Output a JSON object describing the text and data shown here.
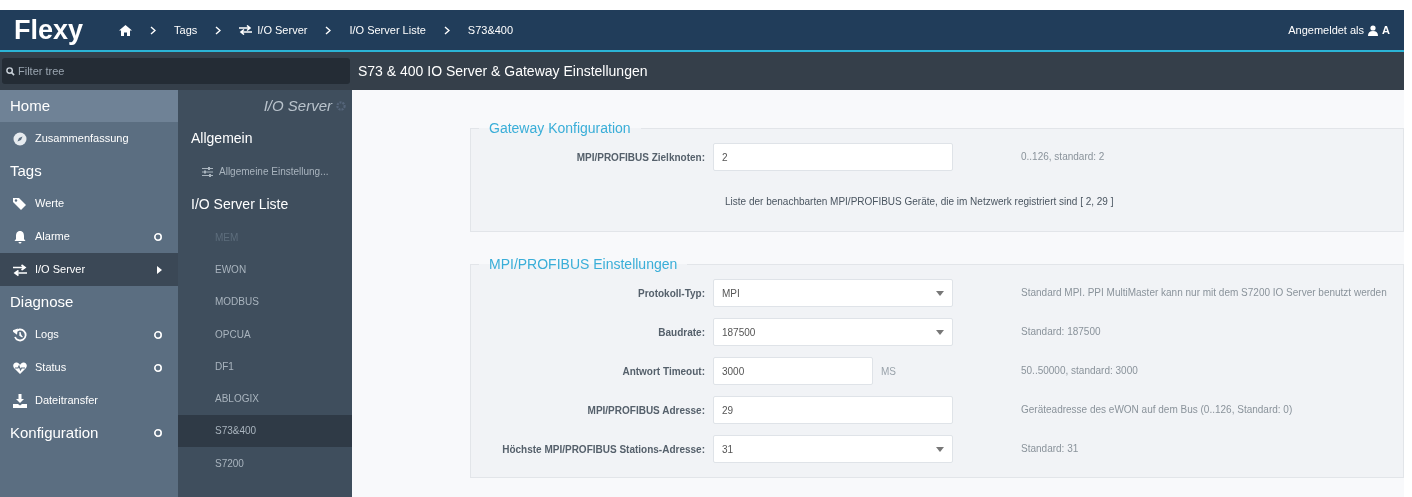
{
  "header": {
    "logo": "Flexy",
    "breadcrumbs": [
      "Tags",
      "I/O Server",
      "I/O Server Liste",
      "S73&400"
    ],
    "login_label": "Angemeldet als",
    "user": "A"
  },
  "filter": {
    "placeholder": "Filter tree"
  },
  "page_title": "S73 & 400 IO Server & Gateway Einstellungen",
  "nav": [
    {
      "kind": "header",
      "label": "Home",
      "selected": true,
      "expandable": false
    },
    {
      "kind": "item",
      "label": "Zusammenfassung",
      "selected": false,
      "expandable": false
    },
    {
      "kind": "header",
      "label": "Tags",
      "selected": false,
      "expandable": false
    },
    {
      "kind": "item",
      "label": "Werte",
      "selected": false,
      "expandable": false
    },
    {
      "kind": "item",
      "label": "Alarme",
      "selected": false,
      "expandable": true
    },
    {
      "kind": "item",
      "label": "I/O Server",
      "selected": true,
      "expandable": false
    },
    {
      "kind": "header",
      "label": "Diagnose",
      "selected": false,
      "expandable": false
    },
    {
      "kind": "item",
      "label": "Logs",
      "selected": false,
      "expandable": true
    },
    {
      "kind": "item",
      "label": "Status",
      "selected": false,
      "expandable": true
    },
    {
      "kind": "item",
      "label": "Dateitransfer",
      "selected": false,
      "expandable": false
    },
    {
      "kind": "header",
      "label": "Konfiguration",
      "selected": false,
      "expandable": true
    }
  ],
  "subnav": {
    "title": "I/O Server",
    "entries": [
      {
        "kind": "header",
        "label": "Allgemein"
      },
      {
        "kind": "setting",
        "label": "Allgemeine Einstellung..."
      },
      {
        "kind": "header",
        "label": "I/O Server Liste"
      },
      {
        "kind": "server",
        "label": "MEM",
        "selected": false,
        "disabled": true
      },
      {
        "kind": "server",
        "label": "EWON",
        "selected": false,
        "disabled": false
      },
      {
        "kind": "server",
        "label": "MODBUS",
        "selected": false,
        "disabled": false
      },
      {
        "kind": "server",
        "label": "OPCUA",
        "selected": false,
        "disabled": false
      },
      {
        "kind": "server",
        "label": "DF1",
        "selected": false,
        "disabled": false
      },
      {
        "kind": "server",
        "label": "ABLOGIX",
        "selected": false,
        "disabled": false
      },
      {
        "kind": "server",
        "label": "S73&400",
        "selected": true,
        "disabled": false
      },
      {
        "kind": "server",
        "label": "S7200",
        "selected": false,
        "disabled": false
      }
    ]
  },
  "sections": [
    {
      "legend": "Gateway Konfiguration",
      "rows": [
        {
          "kind": "input",
          "label": "MPI/PROFIBUS Zielknoten:",
          "value": "2",
          "hint": "0..126, standard: 2"
        },
        {
          "kind": "note",
          "text": "Liste der benachbarten MPI/PROFIBUS Geräte, die im Netzwerk registriert sind [  2, 29  ]"
        }
      ]
    },
    {
      "legend": "MPI/PROFIBUS Einstellungen",
      "rows": [
        {
          "kind": "select",
          "label": "Protokoll-Typ:",
          "value": "MPI",
          "hint": "Standard MPI. PPI MultiMaster kann nur mit dem S7200 IO Server benutzt werden"
        },
        {
          "kind": "select",
          "label": "Baudrate:",
          "value": "187500",
          "hint": "Standard: 187500"
        },
        {
          "kind": "input",
          "label": "Antwort Timeout:",
          "value": "3000",
          "unit": "MS",
          "hint": "50..50000, standard: 3000"
        },
        {
          "kind": "input",
          "label": "MPI/PROFIBUS Adresse:",
          "value": "29",
          "hint": "Geräteadresse des eWON auf dem Bus (0..126, Standard: 0)"
        },
        {
          "kind": "select",
          "label": "Höchste MPI/PROFIBUS Stations-Adresse:",
          "value": "31",
          "hint": "Standard: 31"
        }
      ]
    }
  ]
}
